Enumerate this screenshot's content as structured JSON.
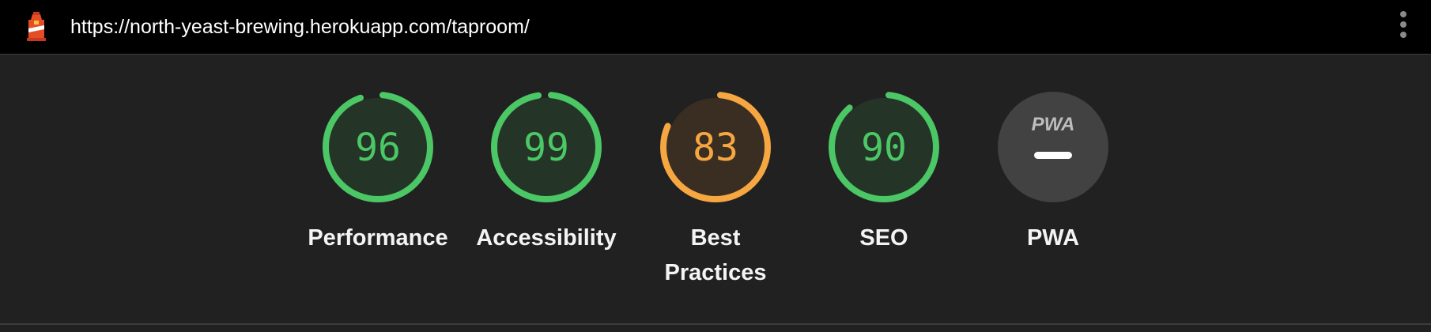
{
  "header": {
    "url": "https://north-yeast-brewing.herokuapp.com/taproom/",
    "logo_icon": "lighthouse-icon",
    "menu_icon": "more-vertical-icon"
  },
  "categories": [
    {
      "id": "performance",
      "label": "Performance",
      "score": "96",
      "fraction": 0.96,
      "status": "pass"
    },
    {
      "id": "accessibility",
      "label": "Accessibility",
      "score": "99",
      "fraction": 0.99,
      "status": "pass"
    },
    {
      "id": "best-practices",
      "label_line1": "Best",
      "label_line2": "Practices",
      "score": "83",
      "fraction": 0.83,
      "status": "average"
    },
    {
      "id": "seo",
      "label": "SEO",
      "score": "90",
      "fraction": 0.9,
      "status": "pass"
    },
    {
      "id": "pwa",
      "label": "PWA",
      "badge": "PWA",
      "status": "not-applicable"
    }
  ],
  "colors": {
    "pass": "#4cc765",
    "pass_fill": "#243528",
    "average": "#f6a741",
    "average_fill": "#3a2e22",
    "na_fill": "#424242",
    "na_text": "#bdbdbd",
    "background": "#212121",
    "topbar": "#000000"
  }
}
